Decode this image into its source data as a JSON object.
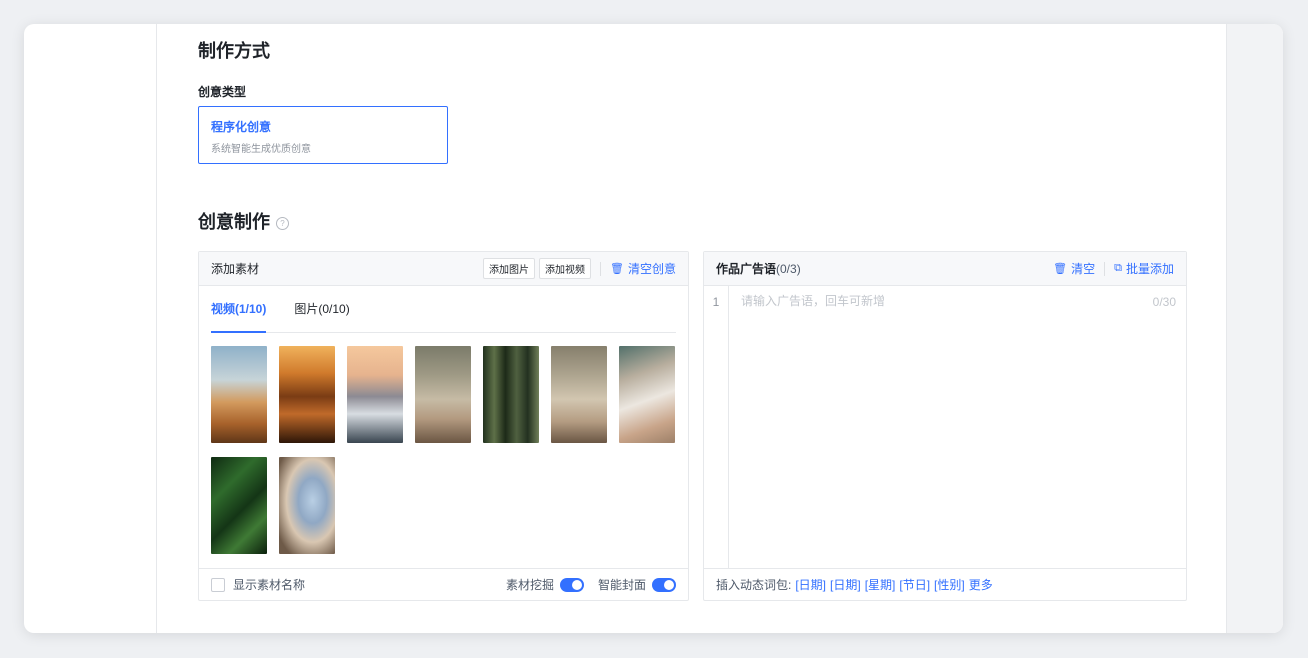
{
  "section_production": {
    "title": "制作方式",
    "label": "创意类型"
  },
  "creative_type": {
    "title": "程序化创意",
    "desc": "系统智能生成优质创意"
  },
  "section_creative": {
    "title": "创意制作",
    "help": "?"
  },
  "materials_panel": {
    "title": "添加素材",
    "add_image_label": "添加图片",
    "add_video_label": "添加视频",
    "clear_label": "清空创意",
    "clear_icon": "trash-icon",
    "tabs": [
      {
        "label": "视频(1/10)",
        "active": true
      },
      {
        "label": "图片(0/10)",
        "active": false
      }
    ],
    "footer": {
      "show_names_label": "显示素材名称",
      "show_names_checked": false,
      "mining_label": "素材挖掘",
      "mining_on": true,
      "smart_cover_label": "智能封面",
      "smart_cover_on": true
    }
  },
  "ad_panel": {
    "title": "作品广告语",
    "count": "(0/3)",
    "clear_label": "清空",
    "clear_icon": "trash-icon",
    "batch_add_label": "批量添加",
    "batch_add_icon": "copy-icon",
    "line_no": "1",
    "input_placeholder": "请输入广告语，回车可新增",
    "input_value": "",
    "counter": "0/30",
    "footer": {
      "insert_label": "插入动态词包:",
      "vars": [
        "[日期]",
        "[日期]",
        "[星期]",
        "[节日]",
        "[性别]"
      ],
      "more_label": "更多"
    }
  },
  "colors": {
    "accent": "#3370ff",
    "border": "#e6e8eb",
    "muted": "#8f959e"
  },
  "thumbnails": [
    {
      "name": "desert-dunes",
      "gradient": "linear-gradient(180deg,#8fb1c9 0%,#c7d4d8 35%,#d29a5e 58%,#a8622b 80%,#5f3618 100%)"
    },
    {
      "name": "sunset-mountains",
      "gradient": "linear-gradient(180deg,#f0b25c 0%,#d07a2c 28%,#7a3c14 52%,#c06a2a 70%,#2e1608 100%)"
    },
    {
      "name": "misty-peaks",
      "gradient": "linear-gradient(180deg,#f5c89d 0%,#e6b38e 30%,#8c8a93 52%,#d8dde2 70%,#394550 100%)"
    },
    {
      "name": "bedroom-lamp",
      "gradient": "linear-gradient(180deg,#7b7b6a 0%,#9f9a85 30%,#c6bba5 55%,#b39a80 75%,#6b5643 100%)"
    },
    {
      "name": "bamboo-forest",
      "gradient": "linear-gradient(90deg,#22321f 0%,#5e7048 20%,#1d2a18 40%,#4f6040 60%,#233120 80%,#71805a 100%)"
    },
    {
      "name": "bedroom-corner",
      "gradient": "linear-gradient(180deg,#867f6c 0%,#ada48f 30%,#d2c6b0 55%,#b49c82 78%,#6a5644 100%)"
    },
    {
      "name": "wedding-invite",
      "gradient": "linear-gradient(160deg,#52706a 0%,#b8ae9e 30%,#ece7e0 55%,#c8a489 80%,#9d8068 100%)"
    },
    {
      "name": "tropical-leaf",
      "gradient": "linear-gradient(135deg,#0f2a12 0%,#2f6b2c 30%,#143516 55%,#3f7a35 75%,#0b200c 100%)"
    },
    {
      "name": "airplane-window",
      "gradient": "radial-gradient(ellipse at 60% 45%,#b9cfe4 0%,#90a8c4 30%,#d9c7b2 55%,#6e5a48 85%)"
    }
  ]
}
